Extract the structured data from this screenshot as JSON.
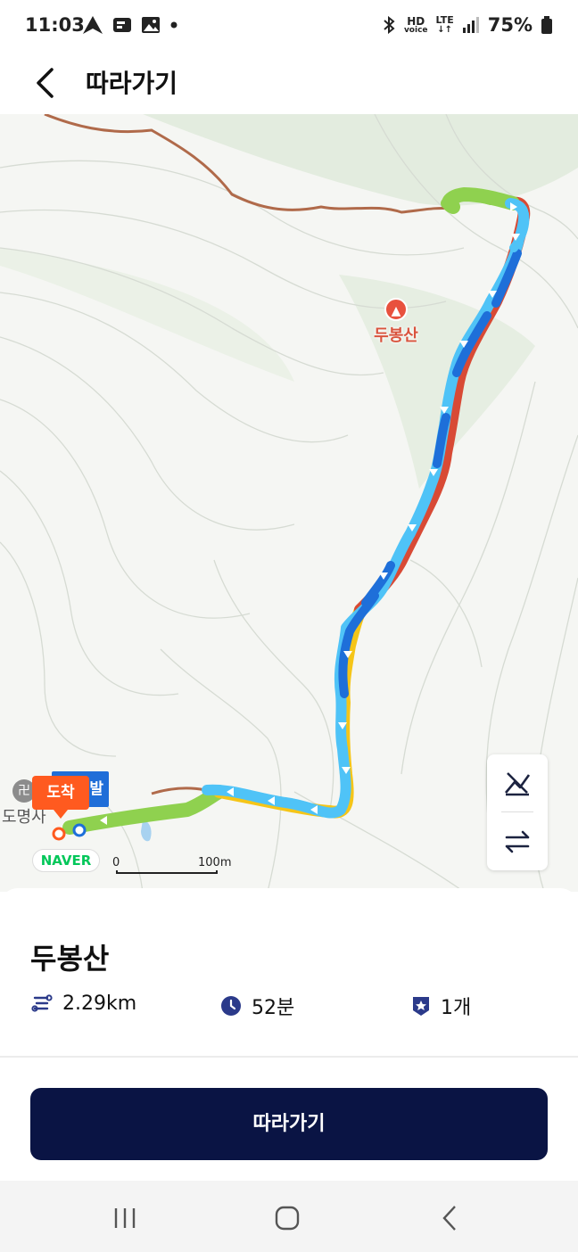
{
  "status_bar": {
    "time": "11:03",
    "battery": "75%",
    "hd_label": "HD",
    "voice_label": "voice",
    "lte_label": "LTE",
    "icons": [
      "navigation-icon",
      "notification-card-icon",
      "gallery-icon",
      "dot-icon",
      "bluetooth-icon",
      "signal-icon",
      "battery-icon"
    ]
  },
  "header": {
    "title": "따라가기",
    "back_icon": "back-arrow-icon"
  },
  "map": {
    "peak_label": "두봉산",
    "temple_label": "도명사",
    "start_label": "출발",
    "arrive_label": "도착",
    "naver_logo": "NAVER",
    "scale_zero": "0",
    "scale_label": "100m",
    "route_colors": {
      "light_blue": "#4fc3f7",
      "blue": "#1e6fd9",
      "green": "#8fd14f",
      "yellow": "#f5c518",
      "red": "#d84a35",
      "trail_brown": "#b06a4a"
    },
    "controls": [
      "elevation-toggle-icon",
      "swap-direction-icon"
    ]
  },
  "course": {
    "name": "두봉산",
    "distance": "2.29km",
    "duration": "52분",
    "peaks": "1개",
    "icons": [
      "distance-icon",
      "clock-icon",
      "peak-badge-icon"
    ]
  },
  "follow_button": {
    "label": "따라가기"
  },
  "nav_bar": {
    "items": [
      "recent-apps-icon",
      "home-icon",
      "back-icon"
    ]
  }
}
